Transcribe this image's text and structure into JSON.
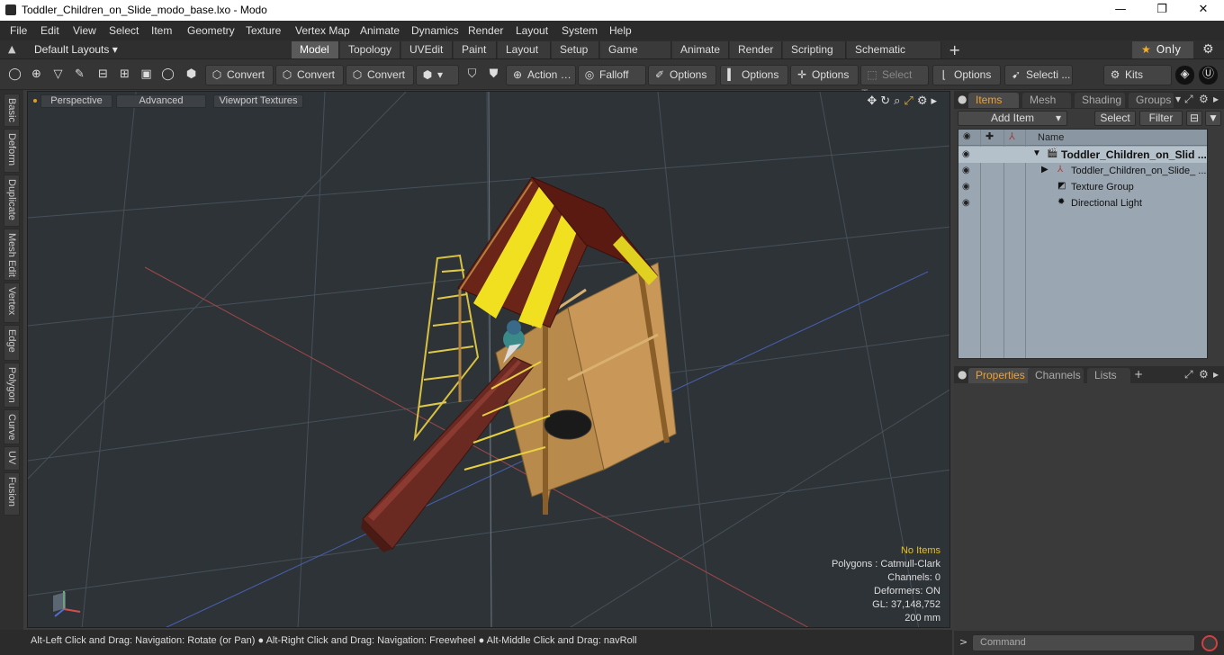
{
  "window": {
    "title": "Toddler_Children_on_Slide_modo_base.lxo - Modo",
    "minimize": "—",
    "maximize": "❐",
    "close": "✕"
  },
  "menu": [
    "File",
    "Edit",
    "View",
    "Select",
    "Item",
    "Geometry",
    "Texture",
    "Vertex Map",
    "Animate",
    "Dynamics",
    "Render",
    "Layout",
    "System",
    "Help"
  ],
  "layouts": {
    "label": "Default Layouts ▾",
    "tabs": [
      "Model",
      "Topology",
      "UVEdit",
      "Paint",
      "Layout",
      "Setup",
      "Game Tools",
      "Animate",
      "Render",
      "Scripting",
      "Schematic Fusion"
    ],
    "active_tab": "Model",
    "add": "+",
    "only_label": "Only",
    "only_star": "★",
    "gear": "⚙"
  },
  "toolbar": {
    "convert_1": "Convert",
    "convert_2": "Convert",
    "convert_3": "Convert",
    "action": "Action",
    "falloff": "Falloff",
    "options_1": "Options",
    "options_2": "Options",
    "options_3": "Options",
    "select_t": "Select T...",
    "options_4": "Options",
    "selecti": "Selecti ...",
    "kits": "Kits"
  },
  "left_tabs": [
    "Basic",
    "Deform",
    "Duplicate",
    "Mesh Edit",
    "Vertex",
    "Edge",
    "Polygon",
    "Curve",
    "UV",
    "Fusion"
  ],
  "viewport": {
    "perspective": "Perspective",
    "advanced": "Advanced",
    "viewport_textures": "Viewport Textures",
    "info": {
      "no_items": "No Items",
      "polygons": "Polygons : Catmull-Clark",
      "channels": "Channels: 0",
      "deformers": "Deformers: ON",
      "gl": "GL: 37,148,752",
      "scale": "200 mm"
    },
    "axis_y": "Y",
    "axis_x": "X",
    "axis_z": "Z"
  },
  "status": {
    "text": "Alt-Left Click and Drag: Navigation: Rotate (or Pan) ● Alt-Right Click and Drag: Navigation: Freewheel ● Alt-Middle Click and Drag: navRoll"
  },
  "items_panel": {
    "tabs": [
      "Items",
      "Mesh ...",
      "Shading",
      "Groups"
    ],
    "active_tab": "Items",
    "add_item": "Add Item",
    "select": "Select",
    "filter": "Filter",
    "name_header": "Name",
    "rows": [
      {
        "label": "Toddler_Children_on_Slid ...",
        "icon": "scene-icon"
      },
      {
        "label": "Toddler_Children_on_Slide_ ...",
        "icon": "mesh-icon"
      },
      {
        "label": "Texture Group",
        "icon": "texture-group-icon"
      },
      {
        "label": "Directional Light",
        "icon": "light-icon"
      }
    ]
  },
  "props_panel": {
    "tabs": [
      "Properties",
      "Channels",
      "Lists"
    ],
    "active_tab": "Properties",
    "add": "+"
  },
  "command": {
    "placeholder": "Command",
    "arrow": ">"
  }
}
